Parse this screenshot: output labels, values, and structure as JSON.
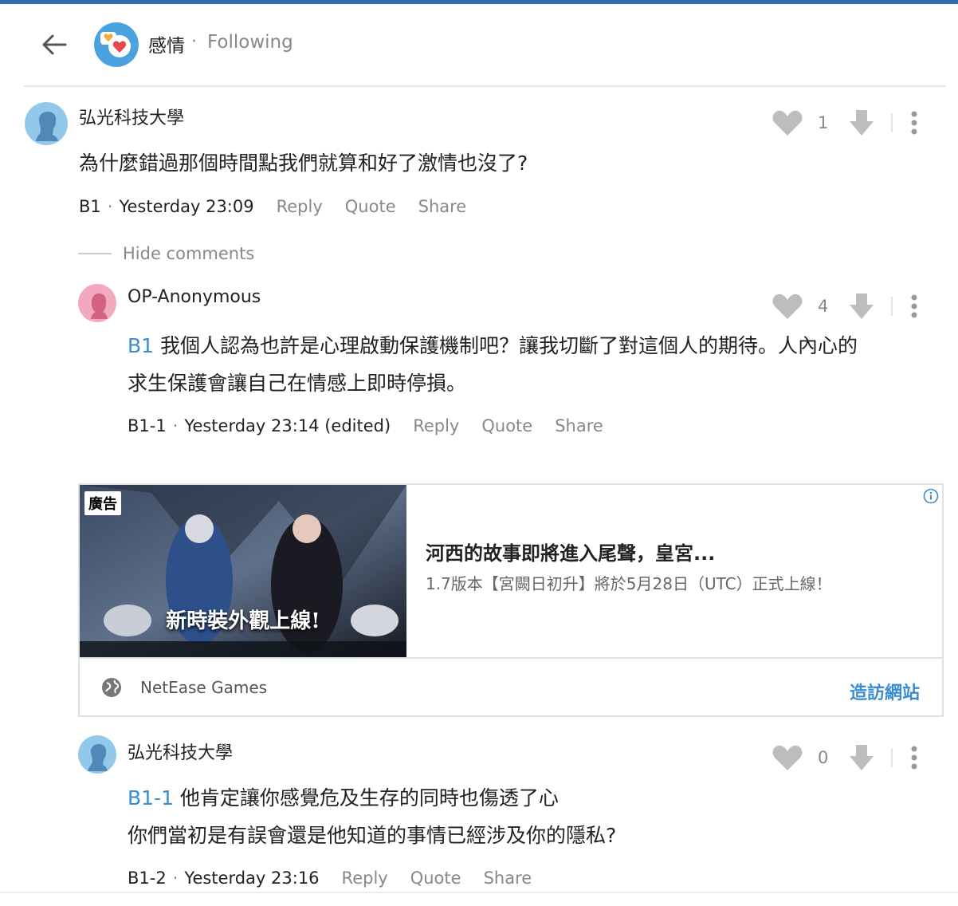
{
  "header": {
    "back_icon": "arrow-left-icon",
    "board_name": "感情",
    "separator": "·",
    "follow_state": "Following"
  },
  "actions_labels": {
    "reply": "Reply",
    "quote": "Quote",
    "share": "Share"
  },
  "comments": [
    {
      "author": "弘光科技大學",
      "text": "為什麼錯過那個時間點我們就算和好了激情也沒了?",
      "floor": "B1",
      "time": "Yesterday 23:09",
      "likes": "1"
    },
    {
      "author": "OP-Anonymous",
      "ref": "B1",
      "text": " 我個人認為也許是心理啟動保護機制吧？讓我切斷了對這個人的期待。人內心的",
      "text2": "求生保護會讓自己在情感上即時停損。",
      "floor": "B1-1",
      "time": "Yesterday 23:14 (edited)",
      "likes": "4"
    },
    {
      "author": "弘光科技大學",
      "ref": "B1-1",
      "text": " 他肯定讓你感覺危及生存的同時也傷透了心",
      "text2": "你們當初是有誤會還是他知道的事情已經涉及你的隱私?",
      "floor": "B1-2",
      "time": "Yesterday 23:16",
      "likes": "0"
    }
  ],
  "hide_comments": "Hide comments",
  "ad": {
    "tag": "廣告",
    "image_text": "新時裝外觀上線!",
    "title": "河西的故事即將進入尾聲，皇宮...",
    "description": "1.7版本【宮闕日初升】將於5月28日（UTC）正式上線！",
    "sponsor": "NetEase Games",
    "cta": "造訪網站"
  },
  "colors": {
    "accent": "#3a8dd0",
    "top_bar": "#2f6fae"
  }
}
